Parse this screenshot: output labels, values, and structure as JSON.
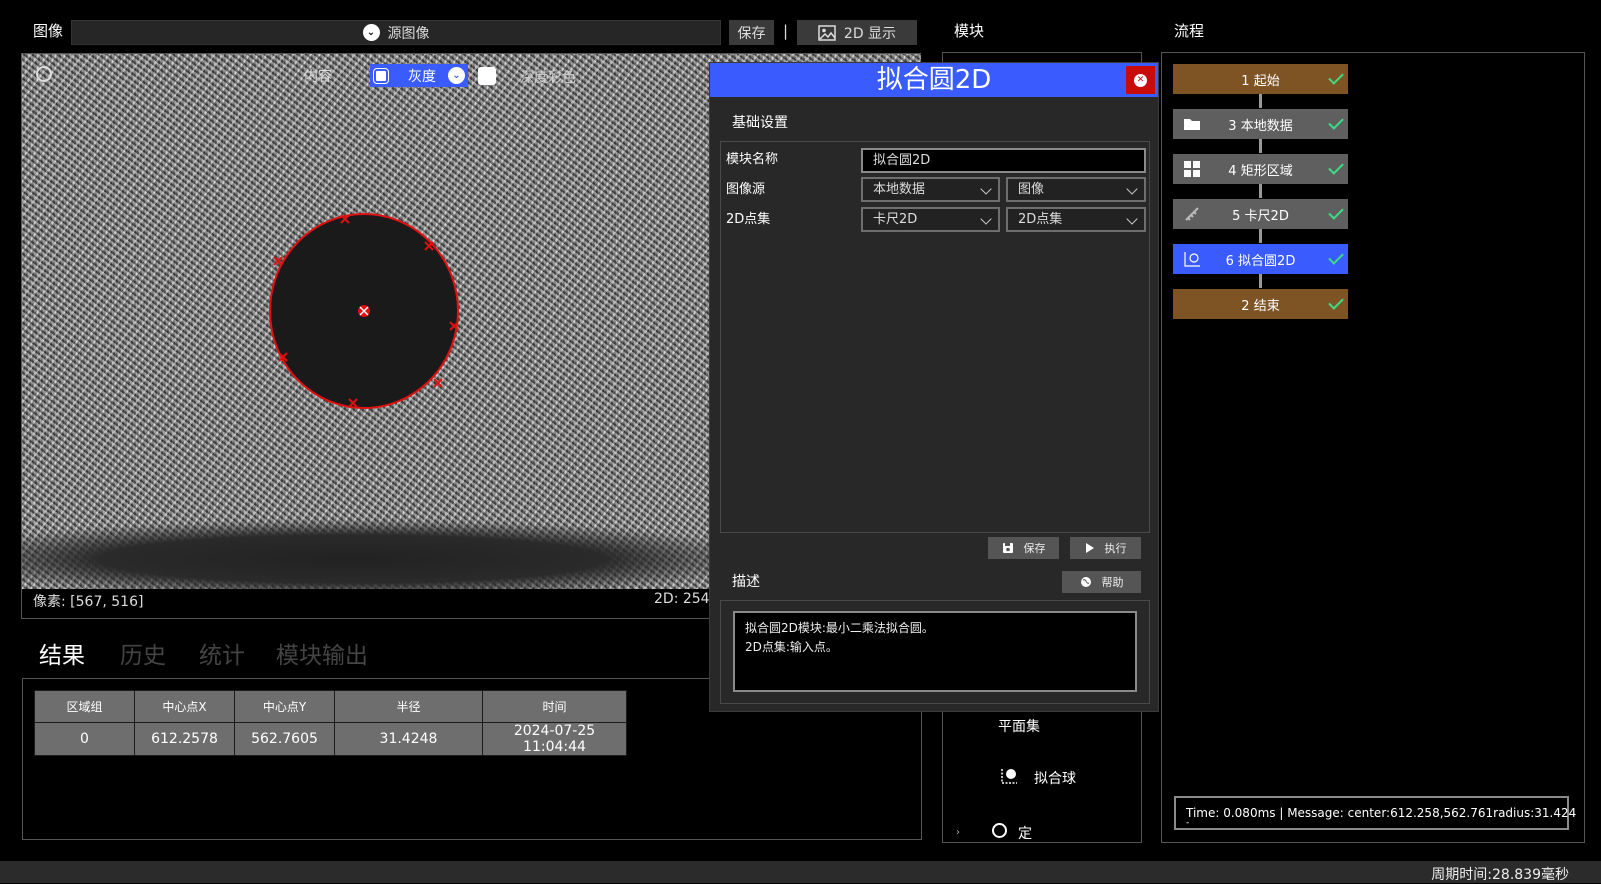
{
  "image_panel": {
    "title": "图像",
    "source_value": "源图像",
    "save_label": "保存",
    "separator": "|",
    "display_mode_label": "2D 显示"
  },
  "viewer_toolbar": {
    "channel_label": "内容",
    "gray_label": "灰度",
    "depth_label": "深度彩色"
  },
  "status": {
    "pixel": "像素: [567, 516]",
    "coord_2d": "2D: 254,"
  },
  "result_tabs": [
    "结果",
    "历史",
    "统计",
    "模块输出"
  ],
  "result_table": {
    "headers": [
      "区域组",
      "中心点X",
      "中心点Y",
      "半径",
      "时间"
    ],
    "rows": [
      [
        "0",
        "612.2578",
        "562.7605",
        "31.4248",
        "2024-07-25 11:04:44"
      ]
    ]
  },
  "dialog": {
    "title": "拟合圆2D",
    "section_basic": "基础设置",
    "module_name_label": "模块名称",
    "module_name_value": "拟合圆2D",
    "image_source_label": "图像源",
    "image_source_values": [
      "本地数据",
      "图像"
    ],
    "point_set_label": "2D点集",
    "point_set_values": [
      "卡尺2D",
      "2D点集"
    ],
    "save_label": "保存",
    "run_label": "执行",
    "section_desc": "描述",
    "help_label": "帮助",
    "description_lines": [
      "拟合圆2D模块:最小二乘法拟合圆。",
      "2D点集:输入点。"
    ]
  },
  "module_panel": {
    "title": "模块",
    "items": [
      "平面集",
      "拟合球",
      "定位"
    ]
  },
  "flow_panel": {
    "title": "流程",
    "nodes": [
      {
        "label": "1 起始",
        "color": "#7f5424"
      },
      {
        "label": "3 本地数据",
        "color": "#5f5f5f"
      },
      {
        "label": "4 矩形区域",
        "color": "#5f5f5f"
      },
      {
        "label": "5 卡尺2D",
        "color": "#5f5f5f"
      },
      {
        "label": "6 拟合圆2D",
        "color": "#3a5cff"
      },
      {
        "label": "2 结束",
        "color": "#7f5424"
      }
    ],
    "message": "Time: 0.080ms  |   Message: center:612.258,562.761radius:31.424",
    "message_tail": "-"
  },
  "footer": {
    "cycle_time": "周期时间:28.839毫秒"
  },
  "colors": {
    "accent_blue": "#3a5cff",
    "close_red": "#c80b0b",
    "check_green": "#3ddc84",
    "fit_red": "#e01010"
  }
}
